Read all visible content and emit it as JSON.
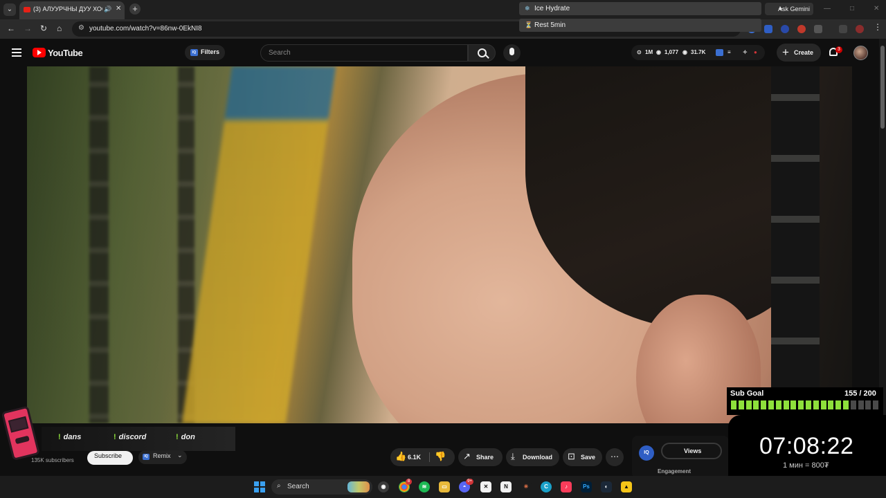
{
  "browser": {
    "tab_title": "(3) АЛУУРЧНЫ ДУУ ХООЛОЙ",
    "url": "youtube.com/watch?v=86nw-0EkNI8",
    "popups": [
      "Ice Hydrate",
      "Rest 5min"
    ],
    "ask_gemini": "Ask Gemini"
  },
  "youtube": {
    "logo_text": "YouTube",
    "filters_label": "Filters",
    "search_placeholder": "Search",
    "stats": {
      "subs": "1M",
      "views": "1,077",
      "likes": "31.7K"
    },
    "create_label": "Create",
    "notification_count": "3"
  },
  "video_meta": {
    "subscribers": "135K subscribers",
    "subscribe_label": "Subscribe",
    "remix_label": "Remix",
    "like_count": "6.1K",
    "share_label": "Share",
    "download_label": "Download",
    "save_label": "Save",
    "panel_tab": "Views",
    "panel_section": "Engagement",
    "panel_badge": "IQ"
  },
  "overlay": {
    "commands": [
      "dans",
      "discord",
      "don"
    ],
    "sub_goal_title": "Sub Goal",
    "sub_goal_count": "155 / 200",
    "sub_goal_progress": 0.775,
    "timer": "07:08:22",
    "rate": "1 мин = 800₮",
    "colors": {
      "goal_filled": "#8ee03b",
      "goal_empty": "#4a4a4a",
      "strip": "#f3e31a"
    }
  },
  "taskbar": {
    "search_label": "Search",
    "badges": {
      "chrome": "8",
      "discord": "9+"
    }
  }
}
